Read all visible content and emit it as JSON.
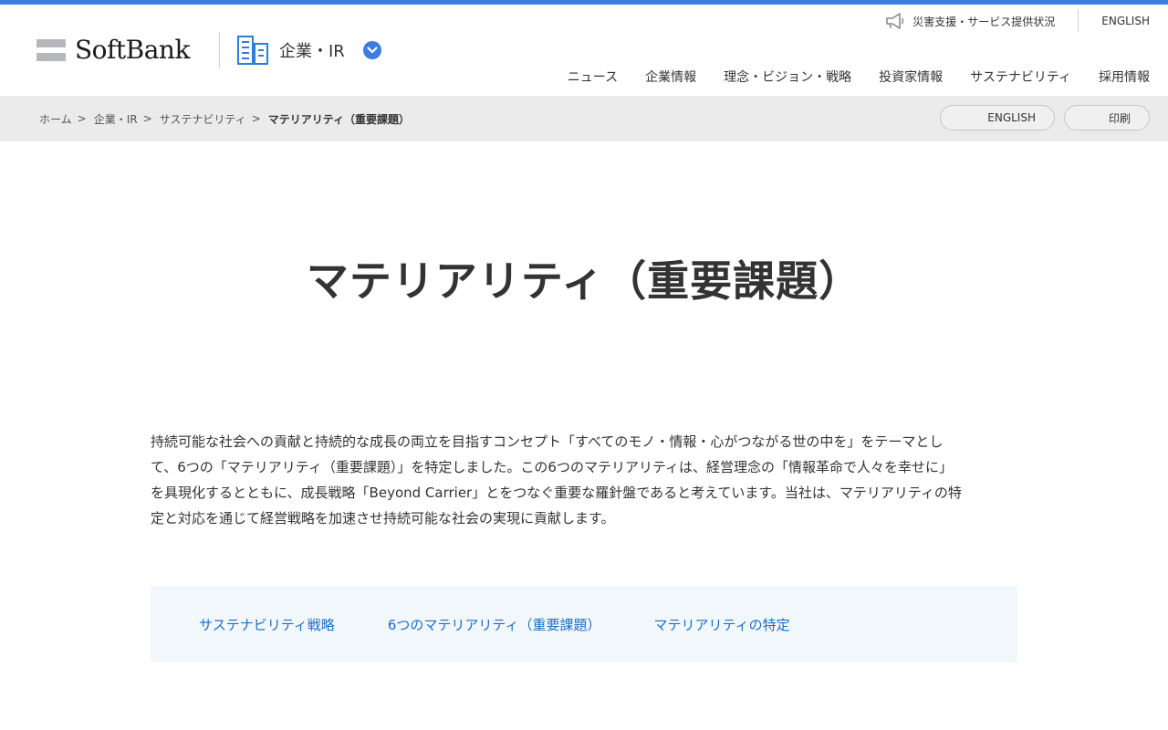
{
  "brand": {
    "logo_text": "SoftBank",
    "accent_color": "#3d7fe0"
  },
  "header": {
    "section_label": "企業・IR",
    "utility": {
      "disaster_link": "災害支援・サービス提供状況",
      "english_link": "ENGLISH"
    },
    "nav": [
      "ニュース",
      "企業情報",
      "理念・ビジョン・戦略",
      "投資家情報",
      "サステナビリティ",
      "採用情報"
    ]
  },
  "breadcrumb": {
    "items": [
      "ホーム",
      "企業・IR",
      "サステナビリティ"
    ],
    "current": "マテリアリティ（重要課題）",
    "separator": ">"
  },
  "actions": {
    "english": "ENGLISH",
    "print": "印刷"
  },
  "main": {
    "title": "マテリアリティ（重要課題）",
    "lead_lines": [
      "持続可能な社会への貢献と持続的な成長の両立を目指すコンセプト「すべてのモノ・情報・心がつながる世の中を」をテーマとし",
      "て、6つの「マテリアリティ（重要課題）」を特定しました。この6つのマテリアリティは、経営理念の「情報革命で人々を幸せに」",
      "を具現化するとともに、成長戦略「Beyond Carrier」とをつなぐ重要な羅針盤であると考えています。当社は、マテリアリティの特",
      "定と対応を通じて経営戦略を加速させ持続可能な社会の実現に貢献します。"
    ],
    "anchor_links": [
      "サステナビリティ戦略",
      "6つのマテリアリティ（重要課題）",
      "マテリアリティの特定"
    ],
    "link_color": "#1b6fc4"
  }
}
